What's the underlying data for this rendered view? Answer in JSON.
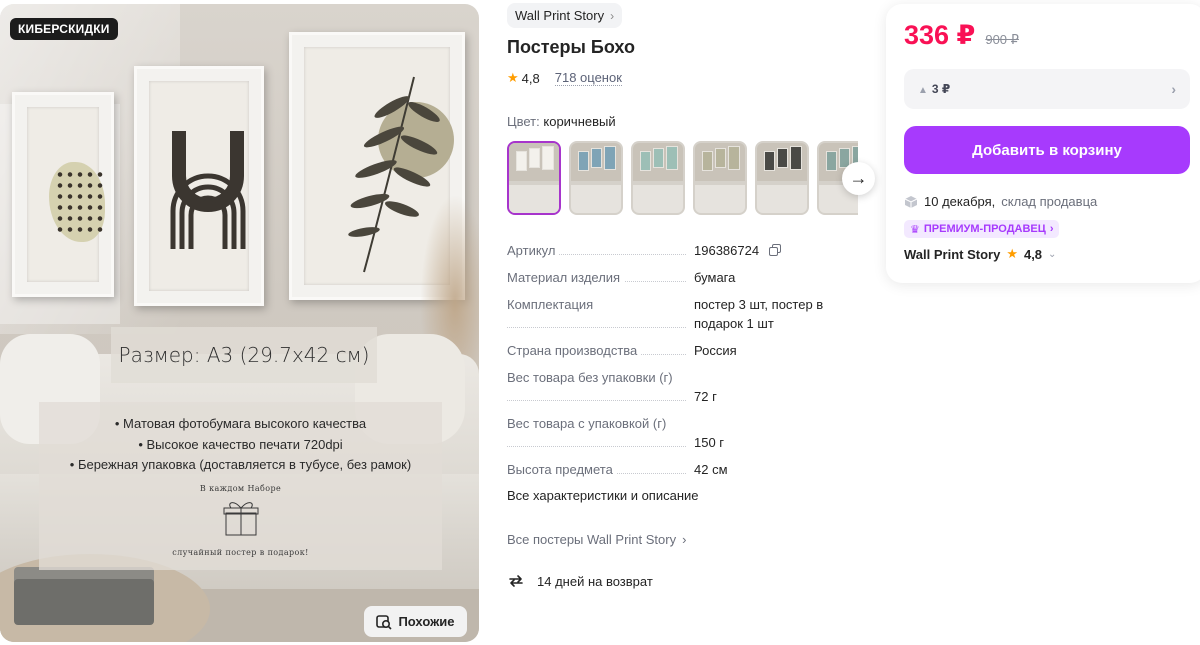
{
  "gallery": {
    "badge": "КИБЕРСКИДКИ",
    "size_text": "Размер: А3  (29.7х42 см)",
    "features": [
      "• Матовая фотобумага высокого качества",
      "• Высокое качество печати 720dpi",
      "• Бережная упаковка (доставляется в тубусе, без рамок)"
    ],
    "gift_top": "В каждом Наборе",
    "gift_bottom": "случайный постер в подарок!",
    "similar_label": "Похожие"
  },
  "product": {
    "brand": "Wall Print Story",
    "title": "Постеры Бохо",
    "rating": "4,8",
    "reviews": "718 оценок",
    "color_label": "Цвет:",
    "color_value": "коричневый"
  },
  "specs": [
    {
      "key": "Артикул",
      "value": "196386724"
    },
    {
      "key": "Материал изделия",
      "value": "бумага"
    },
    {
      "key": "Комплектация",
      "value": "постер 3 шт, постер в подарок 1 шт"
    },
    {
      "key": "Страна производства",
      "value": "Россия"
    },
    {
      "key": "Вес товара без упаковки (г)",
      "value": "72 г"
    },
    {
      "key": "Вес товара с упаковкой (г)",
      "value": "150 г"
    },
    {
      "key": "Высота предмета",
      "value": "42 см"
    }
  ],
  "links": {
    "all_specs": "Все характеристики и описание",
    "all_posters": "Все постеры Wall Print Story",
    "returns": "14 дней на возврат"
  },
  "buy": {
    "price": "336 ₽",
    "old_price": "900 ₽",
    "installment": "3 ₽",
    "add_to_cart": "Добавить в корзину",
    "delivery_date": "10 декабря,",
    "warehouse": "склад продавца",
    "premium": "ПРЕМИУМ-ПРОДАВЕЦ",
    "seller_name": "Wall Print Story",
    "seller_rating": "4,8"
  },
  "colors": {
    "accent": "#a73afd",
    "price": "#f91155",
    "star": "#ff9d00"
  }
}
